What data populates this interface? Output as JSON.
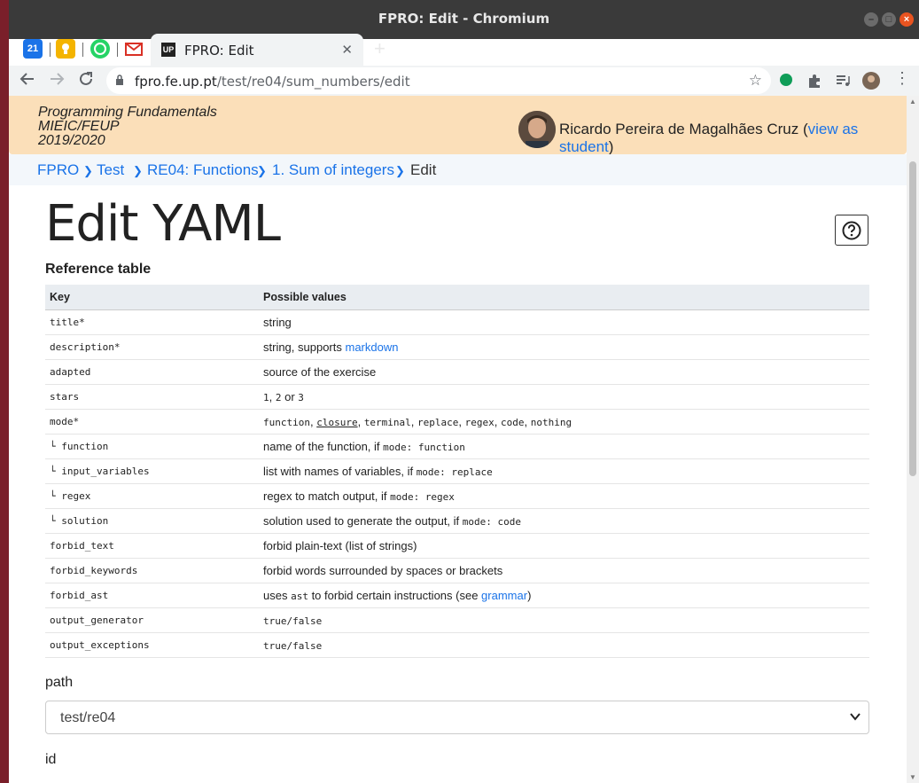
{
  "window": {
    "title": "FPRO: Edit - Chromium"
  },
  "tabs": {
    "mini": [
      "21"
    ],
    "active": {
      "favicon": "UP",
      "label": "FPRO: Edit"
    }
  },
  "toolbar": {
    "url_host": "fpro.fe.up.pt",
    "url_path": "/test/re04/sum_numbers/edit"
  },
  "course": {
    "line1": "Programming Fundamentals",
    "line2": "MIEIC/FEUP",
    "line3": "2019/2020",
    "user_name": "Ricardo Pereira de Magalhães Cruz (",
    "view_as_student": "view as student",
    "user_close": ")"
  },
  "breadcrumb": {
    "items": [
      "FPRO",
      "Test",
      "RE04: Functions",
      "1. Sum of integers"
    ],
    "current": "Edit",
    "separator": "❯"
  },
  "page": {
    "title": "Edit YAML",
    "reference_title": "Reference table"
  },
  "reference": {
    "headers": [
      "Key",
      "Possible values"
    ],
    "rows": [
      {
        "key": "title*",
        "value": "string"
      },
      {
        "key": "description*",
        "value_prefix": "string, supports ",
        "value_link": "markdown"
      },
      {
        "key": "adapted",
        "value": "source of the exercise"
      },
      {
        "key": "stars",
        "v1": "1",
        "v_comma": ", ",
        "v2": "2",
        "v_or": " or ",
        "v3": "3"
      },
      {
        "key": "mode*",
        "m1": "function",
        "m_sep": ", ",
        "m2": "closure",
        "m3": "terminal",
        "m4": "replace",
        "m5": "regex",
        "m6": "code",
        "m7": "nothing"
      },
      {
        "key": "└ function",
        "value_prefix": "name of the function, if ",
        "value_code": "mode: function"
      },
      {
        "key": "└ input_variables",
        "value_prefix": "list with names of variables, if ",
        "value_code": "mode: replace"
      },
      {
        "key": "└ regex",
        "value_prefix": "regex to match output, if ",
        "value_code": "mode: regex"
      },
      {
        "key": "└ solution",
        "value_prefix": "solution used to generate the output, if ",
        "value_code": "mode: code"
      },
      {
        "key": "forbid_text",
        "value": "forbid plain-text (list of strings)"
      },
      {
        "key": "forbid_keywords",
        "value": "forbid words surrounded by spaces or brackets"
      },
      {
        "key": "forbid_ast",
        "value_prefix": "uses ",
        "value_code": "ast",
        "value_mid": " to forbid certain instructions (see ",
        "value_link": "grammar",
        "value_suffix": ")"
      },
      {
        "key": "output_generator",
        "value_code": "true/false"
      },
      {
        "key": "output_exceptions",
        "value_code": "true/false"
      }
    ]
  },
  "form": {
    "path_label": "path",
    "path_value": "test/re04",
    "id_label": "id"
  },
  "colors": {
    "course_bar": "#fbdfb9",
    "link": "#1a73e8",
    "ubuntu_close": "#e95420"
  }
}
